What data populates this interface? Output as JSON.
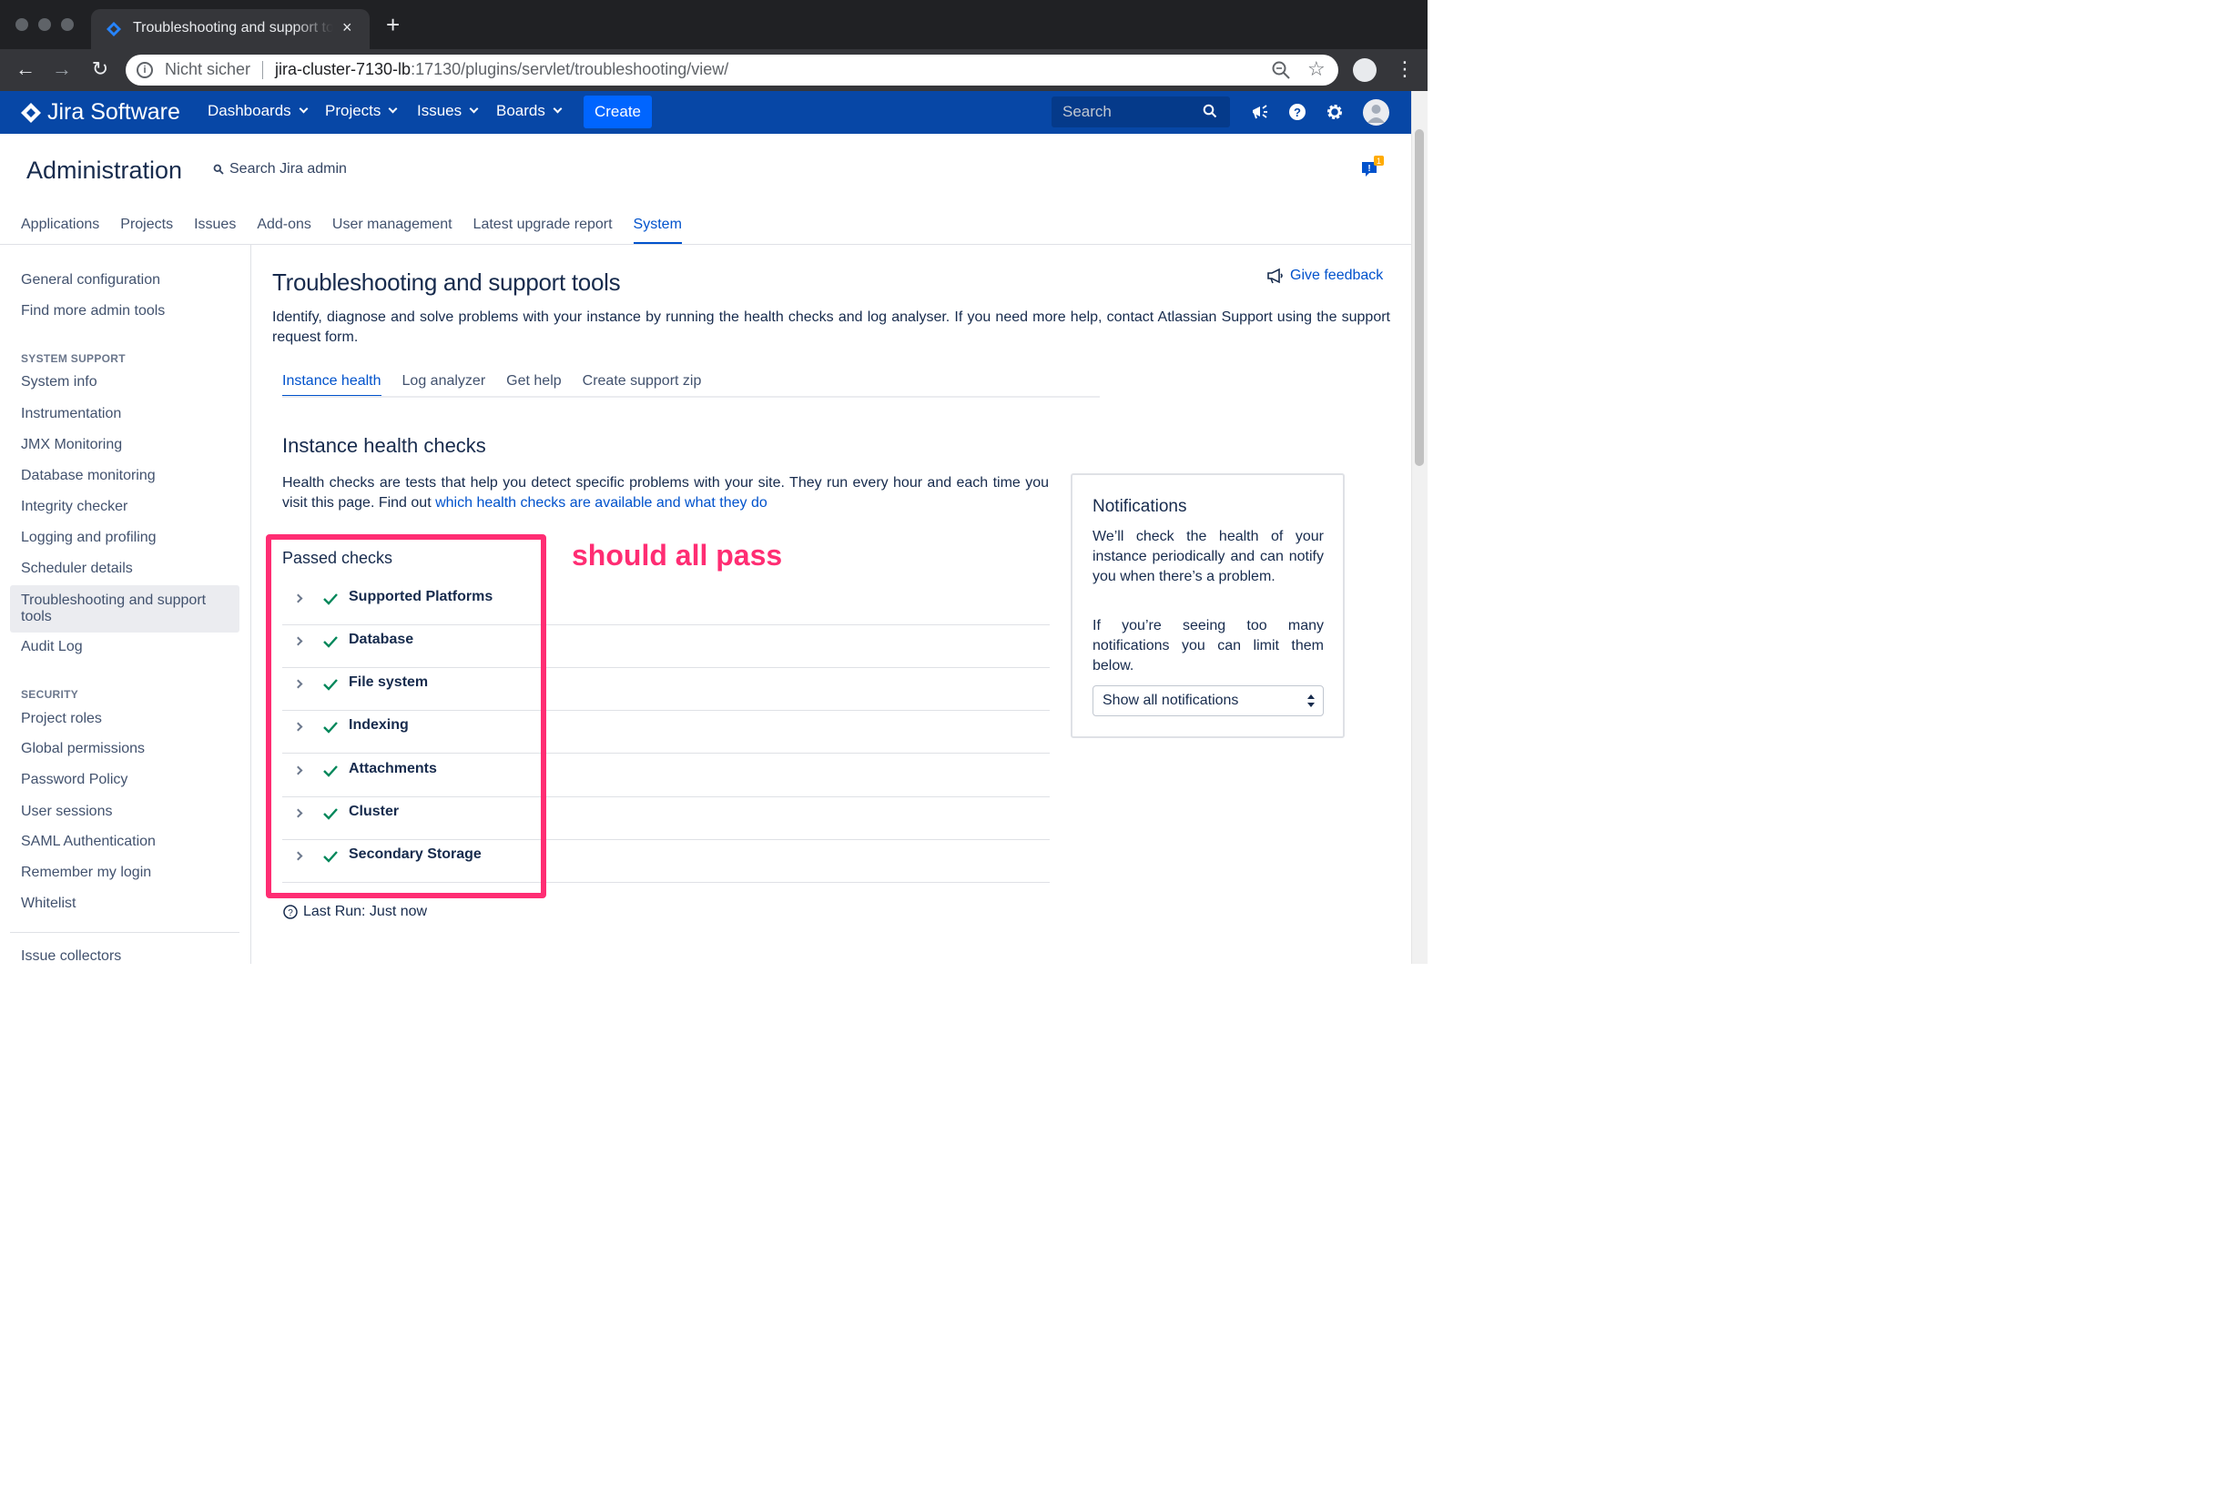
{
  "browser": {
    "tab_title": "Troubleshooting and support tools",
    "new_tab": "+",
    "close_tab": "×",
    "security_label": "Nicht sicher",
    "url_host": "jira-cluster-7130-lb",
    "url_rest": ":17130/plugins/servlet/troubleshooting/view/"
  },
  "jira_header": {
    "product": "Jira Software",
    "nav": [
      "Dashboards",
      "Projects",
      "Issues",
      "Boards"
    ],
    "create_label": "Create",
    "search_placeholder": "Search"
  },
  "admin": {
    "title": "Administration",
    "search_label": "Search Jira admin",
    "feedback_count": "1",
    "tabs": [
      "Applications",
      "Projects",
      "Issues",
      "Add-ons",
      "User management",
      "Latest upgrade report",
      "System"
    ],
    "active_tab": "System"
  },
  "sidebar": {
    "top_items": [
      "General configuration",
      "Find more admin tools"
    ],
    "system_support_heading": "SYSTEM SUPPORT",
    "system_support_items": [
      "System info",
      "Instrumentation",
      "JMX Monitoring",
      "Database monitoring",
      "Integrity checker",
      "Logging and profiling",
      "Scheduler details"
    ],
    "active_item": "Troubleshooting and support tools",
    "after_active_items": [
      "Audit Log"
    ],
    "security_heading": "SECURITY",
    "security_items": [
      "Project roles",
      "Global permissions",
      "Password Policy",
      "User sessions",
      "SAML Authentication",
      "Remember my login",
      "Whitelist"
    ],
    "bottom_items": [
      "Issue collectors"
    ]
  },
  "main": {
    "title": "Troubleshooting and support tools",
    "give_feedback": "Give feedback",
    "description": "Identify, diagnose and solve problems with your instance by running the health checks and log analyser. If you need more help, contact Atlassian Support using the support request form.",
    "tabs": [
      "Instance health",
      "Log analyzer",
      "Get help",
      "Create support zip"
    ],
    "active_tab": "Instance health",
    "section_title": "Instance health checks",
    "section_desc": "Health checks are tests that help you detect specific problems with your site. They run every hour and each time you visit this page. Find out ",
    "section_link": "which health checks are available and what they do",
    "passed_title": "Passed checks",
    "checks": [
      "Supported Platforms",
      "Database",
      "File system",
      "Indexing",
      "Attachments",
      "Cluster",
      "Secondary Storage"
    ],
    "last_run": "Last Run: Just now"
  },
  "notifications": {
    "title": "Notifications",
    "text1": "We’ll check the health of your instance periodically and can notify you when there’s a problem.",
    "text2": "If you’re seeing too many notifications you can limit them below.",
    "select_value": "Show all notifications"
  },
  "annotation": {
    "text": "should all pass",
    "color": "#ff2d73"
  },
  "colors": {
    "jira_blue": "#0747a6",
    "link_blue": "#0052cc",
    "create_blue": "#0065ff",
    "success_green": "#00875a"
  }
}
